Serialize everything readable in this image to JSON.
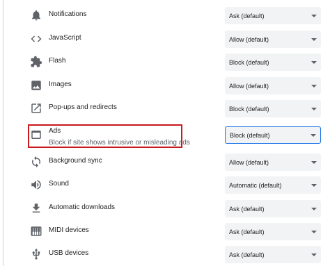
{
  "accent_color": "#1a73e8",
  "highlight_color": "#c8191c",
  "settings": [
    {
      "label": "Notifications",
      "icon": "bell-icon",
      "value": "Ask (default)"
    },
    {
      "label": "JavaScript",
      "icon": "code-icon",
      "value": "Allow (default)"
    },
    {
      "label": "Flash",
      "icon": "puzzle-icon",
      "value": "Block (default)"
    },
    {
      "label": "Images",
      "icon": "image-icon",
      "value": "Allow (default)"
    },
    {
      "label": "Pop-ups and redirects",
      "icon": "external-link-icon",
      "value": "Block (default)"
    },
    {
      "label": "Ads",
      "sublabel": "Block if site shows intrusive or misleading ads",
      "icon": "ads-window-icon",
      "value": "Block (default)"
    },
    {
      "label": "Background sync",
      "icon": "sync-icon",
      "value": "Allow (default)"
    },
    {
      "label": "Sound",
      "icon": "speaker-icon",
      "value": "Automatic (default)"
    },
    {
      "label": "Automatic downloads",
      "icon": "download-icon",
      "value": "Ask (default)"
    },
    {
      "label": "MIDI devices",
      "icon": "midi-icon",
      "value": "Ask (default)"
    },
    {
      "label": "USB devices",
      "icon": "usb-icon",
      "value": "Ask (default)"
    }
  ]
}
